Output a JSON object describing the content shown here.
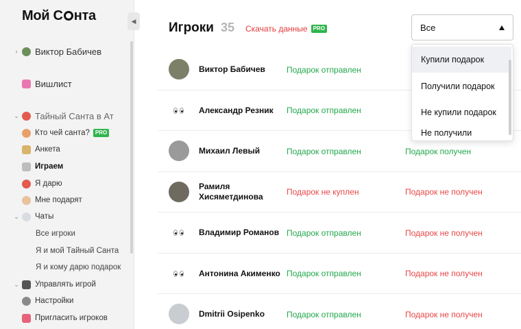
{
  "app": {
    "logo_text_1": "Мой С",
    "logo_text_2": "нта"
  },
  "sidebar": {
    "user_name": "Виктор Бабичев",
    "wishlist": "Вишлист",
    "game_name": "Тайный Санта в Ат",
    "items": {
      "who_whose": "Кто чей санта?",
      "survey": "Анкета",
      "playing": "Играем",
      "i_give": "Я дарю",
      "give_me": "Мне подарят",
      "chats": "Чаты",
      "all_players": "Все игроки",
      "me_and_santa": "Я и мой Тайный Санта",
      "me_and_recipient": "Я и кому дарю подарок",
      "manage": "Управлять игрой",
      "settings": "Настройки",
      "invite": "Пригласить игроков"
    },
    "pro_label": "PRO"
  },
  "header": {
    "title": "Игроки",
    "count": "35",
    "download": "Скачать данные",
    "pro_label": "PRO"
  },
  "filter": {
    "selected": "Все",
    "options": [
      "Купили подарок",
      "Получили подарок",
      "Не купили подарок",
      "Не получили"
    ]
  },
  "players": [
    {
      "name": "Виктор Бабичев",
      "sent": "Подарок отправлен",
      "received": ""
    },
    {
      "name": "Александр Резник",
      "sent": "Подарок отправлен",
      "received": ""
    },
    {
      "name": "Михаил Левый",
      "sent": "Подарок отправлен",
      "received": "Подарок получен"
    },
    {
      "name": "Рамиля Хисяметдинова",
      "sent": "Подарок не куплен",
      "received": "Подарок не получен"
    },
    {
      "name": "Владимир Романов",
      "sent": "Подарок отправлен",
      "received": "Подарок не получен"
    },
    {
      "name": "Антонина Акименко",
      "sent": "Подарок отправлен",
      "received": "Подарок не получен"
    },
    {
      "name": "Dmitrii Osipenko",
      "sent": "Подарок отправлен",
      "received": "Подарок не получен"
    }
  ],
  "colors": {
    "status_ok": "#21a84a",
    "status_bad": "#e94545",
    "pro_badge": "#2fb44b",
    "download_link": "#e23b3b"
  }
}
